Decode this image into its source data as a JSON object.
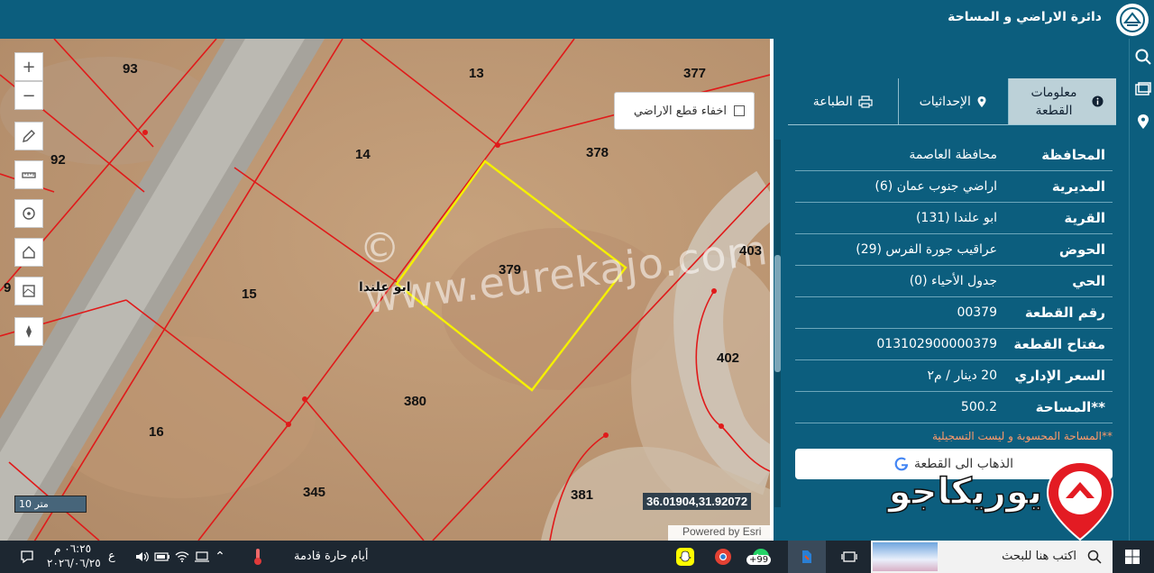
{
  "header": {
    "title": "دائرة الاراضي و المساحة",
    "logo_icon": "dls-logo-icon"
  },
  "map": {
    "parcels": [
      {
        "id": "93"
      },
      {
        "id": "13"
      },
      {
        "id": "377"
      },
      {
        "id": "92"
      },
      {
        "id": "14"
      },
      {
        "id": "378"
      },
      {
        "id": "9"
      },
      {
        "id": "15"
      },
      {
        "id": "379"
      },
      {
        "id": "403"
      },
      {
        "id": "402"
      },
      {
        "id": "380"
      },
      {
        "id": "16"
      },
      {
        "id": "345"
      },
      {
        "id": "381"
      }
    ],
    "place_name": "ابو علندا",
    "watermark": "© www.eurekajo.com",
    "hide_parcels_label": "اخفاء قطع الاراضي",
    "scale_label": "10 متر",
    "coordinates": "36.01904,31.92072",
    "attribution": "Powered by Esri",
    "tools": [
      "zoom-in",
      "zoom-out",
      "draw",
      "measure",
      "locate",
      "home",
      "layers",
      "compass"
    ],
    "colors": {
      "parcel_border": "#e01a1a",
      "selected_parcel": "#f5f000"
    }
  },
  "panel": {
    "tabs": [
      {
        "label": "معلومات القطعة",
        "icon": "info-icon",
        "active": true
      },
      {
        "label": "الإحداثيات",
        "icon": "pin-icon",
        "active": false
      },
      {
        "label": "الطباعة",
        "icon": "print-icon",
        "active": false
      }
    ],
    "rows": [
      {
        "label": "المحافظة",
        "value": "محافظة العاصمة"
      },
      {
        "label": "المديرية",
        "value": "اراضي جنوب عمان (6)"
      },
      {
        "label": "القرية",
        "value": "ابو علندا (131)"
      },
      {
        "label": "الحوض",
        "value": "عراقيب جورة الفرس (29)"
      },
      {
        "label": "الحي",
        "value": "جدول الأحياء (0)"
      },
      {
        "label": "رقم القطعة",
        "value": "00379"
      },
      {
        "label": "مفتاح القطعة",
        "value": "013102900000379"
      },
      {
        "label": "السعر الإداري",
        "value": "20 دينار / م٢"
      },
      {
        "label": "**المساحة",
        "value": "500.2"
      }
    ],
    "note": "**المساحة المحسوبة و ليست التسجيلية",
    "goto_label": "الذهاب الى القطعة",
    "brand_text": "يوريكاجو"
  },
  "taskbar": {
    "search_placeholder": "اكتب هنا للبحث",
    "weather": "أيام حارة قادمة",
    "time": "٠٦:٢٥ م",
    "date": "٢٠٢٦/٠٦/٢٥",
    "lang": "ع",
    "badge": "+99"
  }
}
